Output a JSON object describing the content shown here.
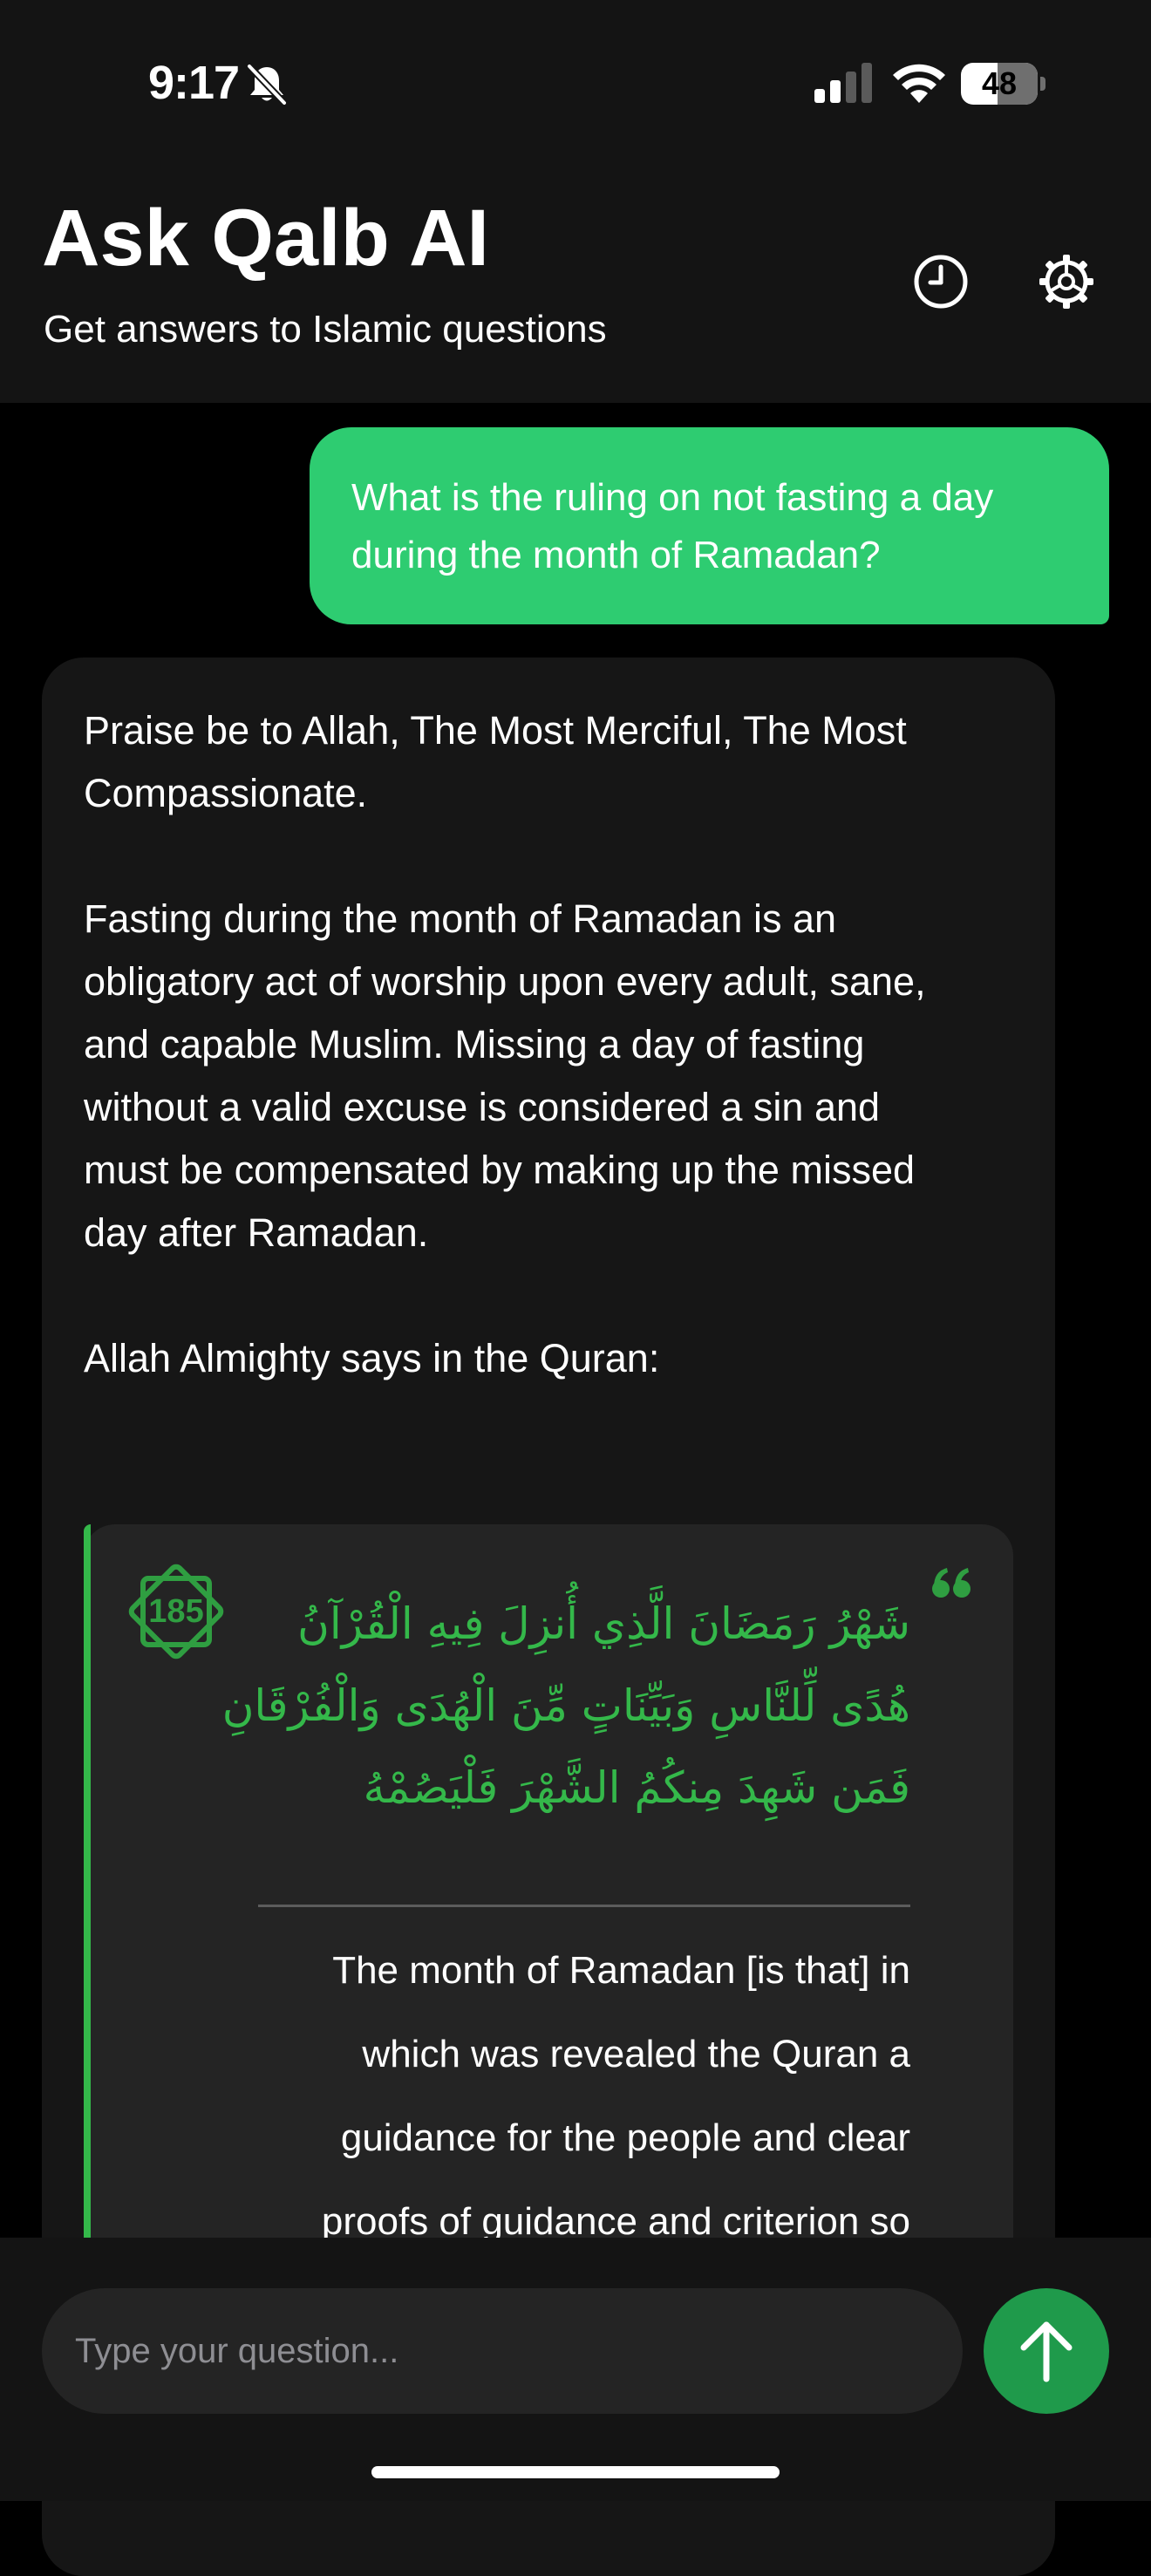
{
  "status_bar": {
    "time": "9:17",
    "battery_level": "48",
    "battery_fraction": 0.48
  },
  "header": {
    "title": "Ask Qalb AI",
    "subtitle": "Get answers to Islamic questions"
  },
  "user_message": {
    "lines": [
      "What is the ruling on not fasting a day",
      "during the month of Ramadan?"
    ]
  },
  "answer": {
    "paragraph_1": [
      "Praise be to Allah, The Most Merciful, The Most",
      "Compassionate."
    ],
    "paragraph_2": [
      "Fasting during the month of Ramadan is an",
      "obligatory act of worship upon every adult, sane,",
      "and capable Muslim. Missing a day of fasting",
      "without a valid excuse is considered a sin and",
      "must be compensated by making up the missed",
      "day after Ramadan."
    ],
    "paragraph_3": [
      "Allah Almighty says in the Quran:"
    ]
  },
  "verse": {
    "number": "185",
    "arabic_lines": [
      "شَهْرُ رَمَضَانَ الَّذِي أُنزِلَ فِيهِ الْقُرْآنُ",
      "هُدًى لِّلنَّاسِ وَبَيِّنَاتٍ مِّنَ الْهُدَى وَالْفُرْقَانِ",
      "فَمَن شَهِدَ مِنكُمُ الشَّهْرَ فَلْيَصُمْهُ"
    ],
    "translation_lines": [
      "The month of Ramadan [is that] in",
      "which was revealed the Quran a",
      "guidance for the people and clear",
      "proofs of guidance and criterion so"
    ]
  },
  "composer": {
    "placeholder": "Type your question..."
  },
  "icons": {
    "bell": "bell-slash-icon",
    "signal": "cellular-signal-icon",
    "wifi": "wifi-icon",
    "battery": "battery-icon",
    "history": "clock-icon",
    "settings": "gear-icon",
    "verse_badge": "octagram-badge-icon",
    "quote": "quote-icon",
    "send": "arrow-up-icon"
  },
  "colors": {
    "accent_green": "#2ecc71",
    "quran_green": "#34b84a",
    "send_green": "#1f9a4b",
    "background": "#000000",
    "header_background": "#141414",
    "card_background": "#161616",
    "verse_background": "#242424"
  }
}
